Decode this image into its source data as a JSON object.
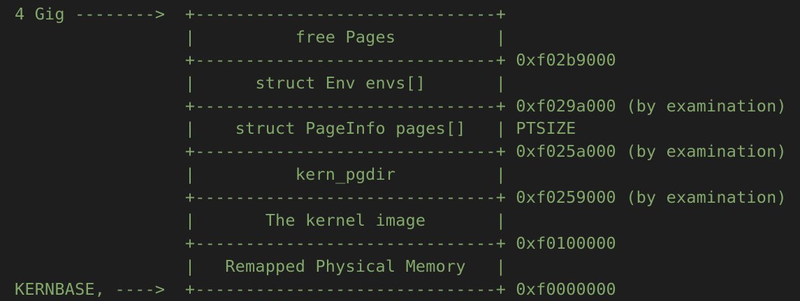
{
  "memory_layout": {
    "lines": [
      "4 Gig -------->  +------------------------------+",
      "                 |          free Pages          |",
      "                 +------------------------------+ 0xf02b9000",
      "                 |      struct Env envs[]       |",
      "                 +------------------------------+ 0xf029a000 (by examination)",
      "                 |    struct PageInfo pages[]   | PTSIZE",
      "                 +------------------------------+ 0xf025a000 (by examination)",
      "                 |          kern_pgdir          |",
      "                 +------------------------------+ 0xf0259000 (by examination)",
      "                 |       The kernel image       |",
      "                 +------------------------------+ 0xf0100000",
      "                 |   Remapped Physical Memory   |",
      "KERNBASE, ---->  +------------------------------+ 0xf0000000"
    ]
  },
  "colors": {
    "background": "#1e1e1e",
    "text": "#82a86a"
  }
}
